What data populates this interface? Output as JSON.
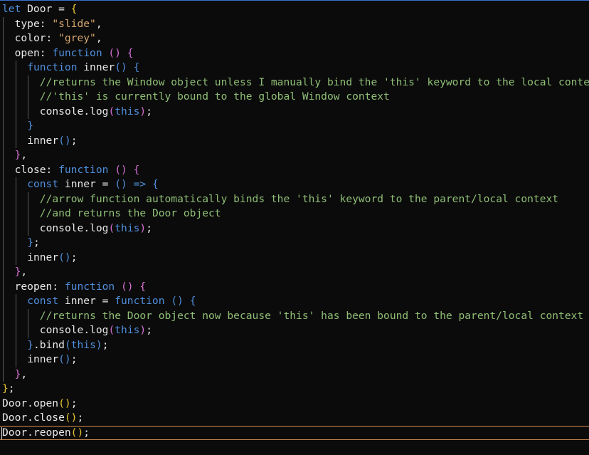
{
  "editor": {
    "accent_color": "#d08a52",
    "lines": [
      {
        "indent": 0,
        "tokens": [
          [
            "kw",
            "let"
          ],
          [
            "id",
            " Door "
          ],
          [
            "punc",
            "= "
          ],
          [
            "br1",
            "{"
          ]
        ]
      },
      {
        "indent": 1,
        "tokens": [
          [
            "prop",
            "type"
          ],
          [
            "punc",
            ": "
          ],
          [
            "str",
            "\"slide\""
          ],
          [
            "punc",
            ","
          ]
        ]
      },
      {
        "indent": 1,
        "tokens": [
          [
            "prop",
            "color"
          ],
          [
            "punc",
            ": "
          ],
          [
            "str",
            "\"grey\""
          ],
          [
            "punc",
            ","
          ]
        ]
      },
      {
        "indent": 1,
        "tokens": [
          [
            "prop",
            "open"
          ],
          [
            "punc",
            ": "
          ],
          [
            "kw",
            "function"
          ],
          [
            "punc",
            " "
          ],
          [
            "br2",
            "()"
          ],
          [
            "punc",
            " "
          ],
          [
            "br2",
            "{"
          ]
        ]
      },
      {
        "indent": 2,
        "tokens": [
          [
            "kw",
            "function"
          ],
          [
            "id",
            " inner"
          ],
          [
            "br3",
            "()"
          ],
          [
            "punc",
            " "
          ],
          [
            "br3",
            "{"
          ]
        ]
      },
      {
        "indent": 3,
        "tokens": [
          [
            "cm",
            "//returns the Window object unless I manually bind the 'this' keyword to the local context"
          ]
        ]
      },
      {
        "indent": 3,
        "tokens": [
          [
            "cm",
            "//'this' is currently bound to the global Window context"
          ]
        ]
      },
      {
        "indent": 3,
        "tokens": [
          [
            "id",
            "console"
          ],
          [
            "punc",
            "."
          ],
          [
            "id",
            "log"
          ],
          [
            "br2",
            "("
          ],
          [
            "kw",
            "this"
          ],
          [
            "br2",
            ")"
          ],
          [
            "punc",
            ";"
          ]
        ]
      },
      {
        "indent": 2,
        "tokens": [
          [
            "br3",
            "}"
          ]
        ]
      },
      {
        "indent": 2,
        "tokens": [
          [
            "id",
            "inner"
          ],
          [
            "br3",
            "()"
          ],
          [
            "punc",
            ";"
          ]
        ]
      },
      {
        "indent": 1,
        "tokens": [
          [
            "br2",
            "}"
          ],
          [
            "punc",
            ","
          ]
        ]
      },
      {
        "indent": 1,
        "tokens": [
          [
            "prop",
            "close"
          ],
          [
            "punc",
            ": "
          ],
          [
            "kw",
            "function"
          ],
          [
            "punc",
            " "
          ],
          [
            "br2",
            "()"
          ],
          [
            "punc",
            " "
          ],
          [
            "br2",
            "{"
          ]
        ]
      },
      {
        "indent": 2,
        "tokens": [
          [
            "kw",
            "const"
          ],
          [
            "id",
            " inner "
          ],
          [
            "punc",
            "= "
          ],
          [
            "br3",
            "()"
          ],
          [
            "punc",
            " "
          ],
          [
            "arrow",
            "=>"
          ],
          [
            "punc",
            " "
          ],
          [
            "br3",
            "{"
          ]
        ]
      },
      {
        "indent": 3,
        "tokens": [
          [
            "cm",
            "//arrow function automatically binds the 'this' keyword to the parent/local context"
          ]
        ]
      },
      {
        "indent": 3,
        "tokens": [
          [
            "cm",
            "//and returns the Door object"
          ]
        ]
      },
      {
        "indent": 3,
        "tokens": [
          [
            "id",
            "console"
          ],
          [
            "punc",
            "."
          ],
          [
            "id",
            "log"
          ],
          [
            "br2",
            "("
          ],
          [
            "kw",
            "this"
          ],
          [
            "br2",
            ")"
          ],
          [
            "punc",
            ";"
          ]
        ]
      },
      {
        "indent": 2,
        "tokens": [
          [
            "br3",
            "}"
          ],
          [
            "punc",
            ";"
          ]
        ]
      },
      {
        "indent": 2,
        "tokens": [
          [
            "id",
            "inner"
          ],
          [
            "br3",
            "()"
          ],
          [
            "punc",
            ";"
          ]
        ]
      },
      {
        "indent": 1,
        "tokens": [
          [
            "br2",
            "}"
          ],
          [
            "punc",
            ","
          ]
        ]
      },
      {
        "indent": 1,
        "tokens": [
          [
            "prop",
            "reopen"
          ],
          [
            "punc",
            ": "
          ],
          [
            "kw",
            "function"
          ],
          [
            "punc",
            " "
          ],
          [
            "br2",
            "()"
          ],
          [
            "punc",
            " "
          ],
          [
            "br2",
            "{"
          ]
        ]
      },
      {
        "indent": 2,
        "tokens": [
          [
            "kw",
            "const"
          ],
          [
            "id",
            " inner "
          ],
          [
            "punc",
            "= "
          ],
          [
            "kw",
            "function"
          ],
          [
            "punc",
            " "
          ],
          [
            "br3",
            "()"
          ],
          [
            "punc",
            " "
          ],
          [
            "br3",
            "{"
          ]
        ]
      },
      {
        "indent": 3,
        "tokens": [
          [
            "cm",
            "//returns the Door object now because 'this' has been bound to the parent/local context"
          ]
        ]
      },
      {
        "indent": 3,
        "tokens": [
          [
            "id",
            "console"
          ],
          [
            "punc",
            "."
          ],
          [
            "id",
            "log"
          ],
          [
            "br2",
            "("
          ],
          [
            "kw",
            "this"
          ],
          [
            "br2",
            ")"
          ],
          [
            "punc",
            ";"
          ]
        ]
      },
      {
        "indent": 2,
        "tokens": [
          [
            "br3",
            "}"
          ],
          [
            "punc",
            "."
          ],
          [
            "id",
            "bind"
          ],
          [
            "br3",
            "("
          ],
          [
            "kw",
            "this"
          ],
          [
            "br3",
            ")"
          ],
          [
            "punc",
            ";"
          ]
        ]
      },
      {
        "indent": 2,
        "tokens": [
          [
            "id",
            "inner"
          ],
          [
            "br3",
            "()"
          ],
          [
            "punc",
            ";"
          ]
        ]
      },
      {
        "indent": 1,
        "tokens": [
          [
            "br2",
            "}"
          ],
          [
            "punc",
            ","
          ]
        ]
      },
      {
        "indent": 0,
        "tokens": [
          [
            "br1",
            "}"
          ],
          [
            "punc",
            ";"
          ]
        ]
      },
      {
        "indent": 0,
        "tokens": [
          [
            "id",
            "Door"
          ],
          [
            "punc",
            "."
          ],
          [
            "id",
            "open"
          ],
          [
            "br1",
            "()"
          ],
          [
            "punc",
            ";"
          ]
        ]
      },
      {
        "indent": 0,
        "tokens": [
          [
            "id",
            "Door"
          ],
          [
            "punc",
            "."
          ],
          [
            "id",
            "close"
          ],
          [
            "br1",
            "()"
          ],
          [
            "punc",
            ";"
          ]
        ]
      },
      {
        "indent": 0,
        "cursor": true,
        "tokens": [
          [
            "id",
            "Door"
          ],
          [
            "punc",
            "."
          ],
          [
            "id",
            "reopen"
          ],
          [
            "br1",
            "()"
          ],
          [
            "punc",
            ";"
          ]
        ]
      }
    ]
  }
}
